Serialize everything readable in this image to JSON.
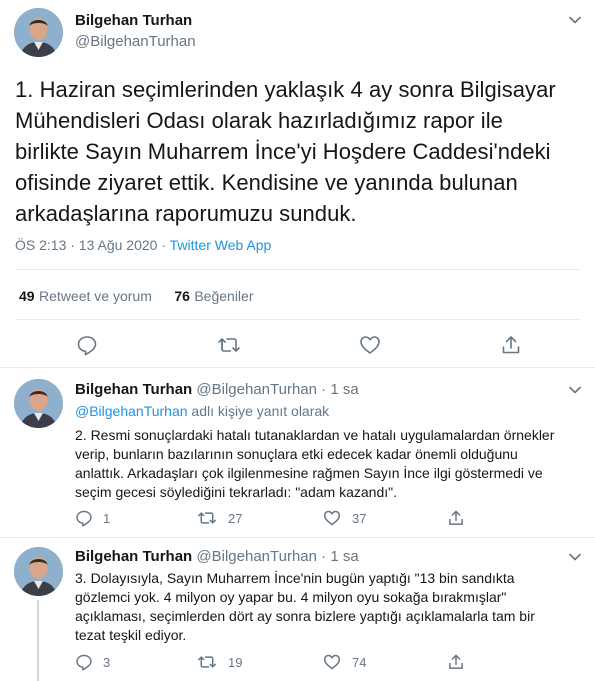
{
  "main_tweet": {
    "name": "Bilgehan Turhan",
    "handle": "@BilgehanTurhan",
    "text_lines": [
      "1. Haziran seçimlerinden yaklaşık 4 ay sonra Bilgisayar",
      "Mühendisleri Odası olarak hazırladığımız rapor ile",
      "birlikte Sayın Muharrem İnce'yi Hoşdere Caddesi'ndeki",
      "ofisinde ziyaret ettik. Kendisine ve yanında bulunan",
      "arkadaşlarına raporumuzu sunduk."
    ],
    "timestamp": "ÖS 2:13 · 13 Ağu 2020 · ",
    "source": "Twitter Web App",
    "retweets_count": "49",
    "retweets_label": "Retweet ve yorum",
    "likes_count": "76",
    "likes_label": "Beğeniler"
  },
  "replies": [
    {
      "name": "Bilgehan Turhan",
      "handle": "@BilgehanTurhan",
      "time": "· 1 sa",
      "reply_to_handle": "@BilgehanTurhan",
      "reply_to_label": " adlı kişiye yanıt olarak",
      "text_lines": [
        "2. Resmi sonuçlardaki hatalı tutanaklardan ve hatalı uygulamalardan örnekler",
        "verip, bunların bazılarının sonuçlara etki edecek kadar önemli olduğunu",
        "anlattık. Arkadaşları çok ilgilenmesine rağmen Sayın İnce ilgi göstermedi ve",
        "seçim gecesi söylediğini tekrarladı: \"adam kazandı\"."
      ],
      "replies_count": "1",
      "retweets_count": "27",
      "likes_count": "37"
    },
    {
      "name": "Bilgehan Turhan",
      "handle": "@BilgehanTurhan",
      "time": "· 1 sa",
      "text_lines": [
        "3. Dolayısıyla, Sayın Muharrem İnce'nin bugün yaptığı \"13 bin sandıkta",
        "gözlemci yok. 4 milyon oy yapar bu. 4 milyon oyu sokağa bırakmışlar\"",
        "açıklaması, seçimlerden dört ay sonra bizlere yaptığı açıklamalarla tam bir",
        "tezat teşkil ediyor."
      ],
      "replies_count": "3",
      "retweets_count": "19",
      "likes_count": "74"
    }
  ],
  "colors": {
    "link": "#1b95e0",
    "muted": "#657786",
    "divider": "#e6ecf0"
  },
  "icons": [
    "chevron-down-icon",
    "reply-icon",
    "retweet-icon",
    "like-icon",
    "share-icon"
  ]
}
